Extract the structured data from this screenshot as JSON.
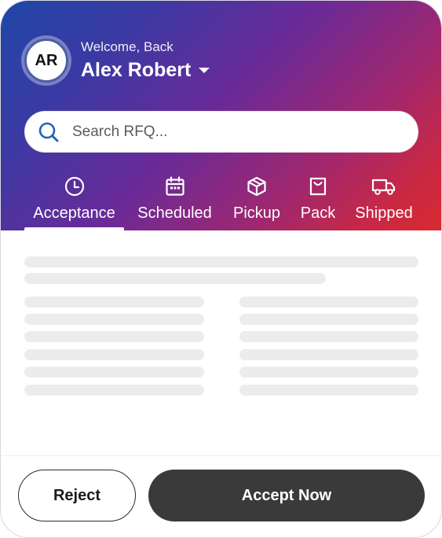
{
  "header": {
    "greeting": "Welcome, Back",
    "avatar_initials": "AR",
    "user_name": "Alex Robert"
  },
  "search": {
    "placeholder": "Search RFQ..."
  },
  "tabs": [
    {
      "label": "Acceptance",
      "icon": "clock-icon",
      "active": true
    },
    {
      "label": "Scheduled",
      "icon": "calendar-icon",
      "active": false
    },
    {
      "label": "Pickup",
      "icon": "package-box-icon",
      "active": false
    },
    {
      "label": "Pack",
      "icon": "bag-icon",
      "active": false
    },
    {
      "label": "Shipped",
      "icon": "truck-icon",
      "active": false
    }
  ],
  "footer": {
    "reject_label": "Reject",
    "accept_label": "Accept Now"
  },
  "colors": {
    "gradient_start": "#1f46a6",
    "gradient_mid": "#6a2a98",
    "gradient_end": "#d92a2f",
    "skeleton": "#ececef",
    "accept_button": "#3a3a3b"
  }
}
